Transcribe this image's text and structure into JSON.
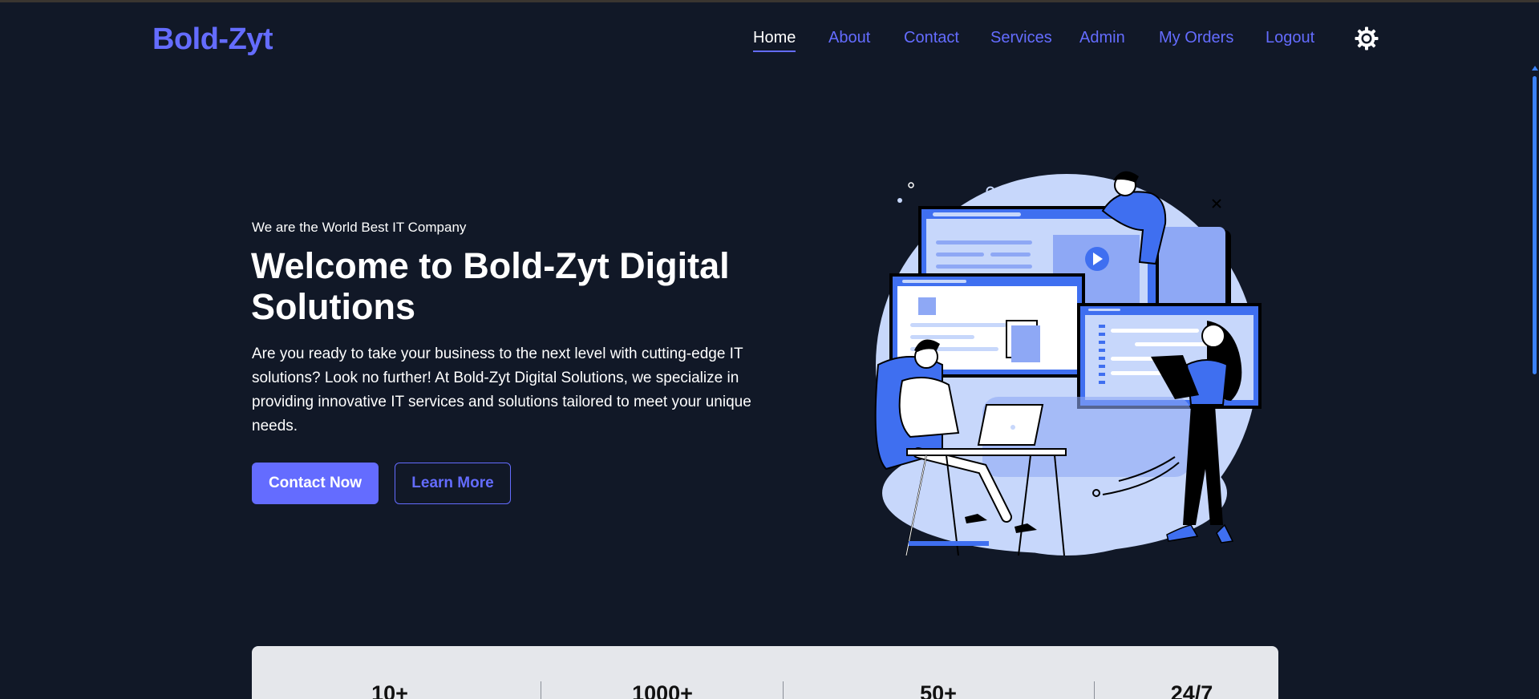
{
  "header": {
    "logo": "Bold-Zyt",
    "nav": [
      {
        "label": "Home",
        "active": true
      },
      {
        "label": "About",
        "active": false
      },
      {
        "label": "Contact",
        "active": false
      },
      {
        "label": "Services",
        "active": false
      },
      {
        "label": "Admin",
        "active": false
      },
      {
        "label": "My Orders",
        "active": false
      },
      {
        "label": "Logout",
        "active": false
      }
    ],
    "theme_toggle_icon": "sun-icon"
  },
  "hero": {
    "tagline": "We are the World Best IT Company",
    "title": "Welcome to Bold-Zyt Digital Solutions",
    "description": "Are you ready to take your business to the next level with cutting-edge IT solutions? Look no further! At Bold-Zyt Digital Solutions, we specialize in providing innovative IT services and solutions tailored to meet your unique needs.",
    "primary_button": "Contact Now",
    "secondary_button": "Learn More",
    "illustration": "team-working-on-websites-illustration"
  },
  "stats": {
    "items": [
      {
        "value": "10+"
      },
      {
        "value": "1000+"
      },
      {
        "value": "50+"
      },
      {
        "value": "24/7"
      }
    ]
  },
  "colors": {
    "background": "#111827",
    "accent": "#646cff",
    "text": "#ffffff",
    "stats_background": "#e5e7eb",
    "scrollbar": "#3b82f6"
  }
}
